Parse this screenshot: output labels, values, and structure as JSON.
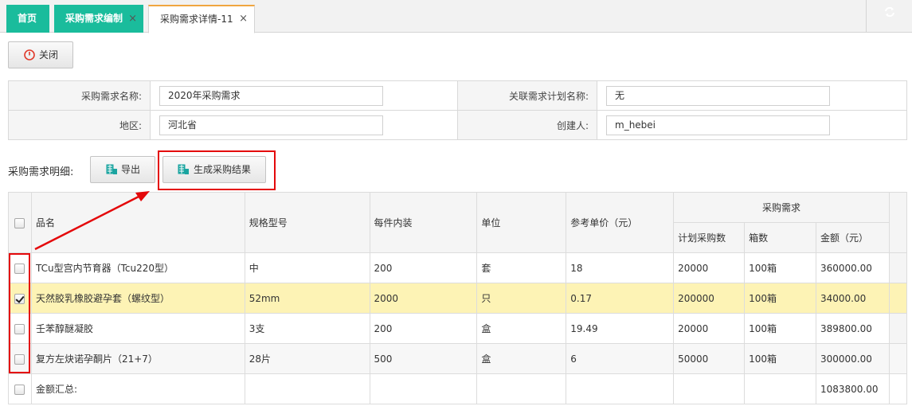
{
  "tabs": {
    "home": "首页",
    "edit": "采购需求编制",
    "detail": "采购需求详情-11",
    "close_glyph": "×"
  },
  "toolbar": {
    "close_label": "关闭"
  },
  "form": {
    "name_label": "采购需求名称:",
    "name_value": "2020年采购需求",
    "plan_label": "关联需求计划名称:",
    "plan_value": "无",
    "region_label": "地区:",
    "region_value": "河北省",
    "creator_label": "创建人:",
    "creator_value": "m_hebei"
  },
  "detail": {
    "label": "采购需求明细:",
    "export_label": "导出",
    "generate_label": "生成采购结果"
  },
  "grid": {
    "headers": {
      "name": "品名",
      "spec": "规格型号",
      "pack": "每件内装",
      "unit": "单位",
      "price": "参考单价（元）",
      "demand_group": "采购需求",
      "plan_qty": "计划采购数",
      "boxes": "箱数",
      "amount": "金额（元）"
    },
    "rows": [
      {
        "name": "TCu型宫内节育器（Tcu220型）",
        "spec": "中",
        "pack": "200",
        "unit": "套",
        "price": "18",
        "plan_qty": "20000",
        "boxes": "100箱",
        "amount": "360000.00",
        "checked": false
      },
      {
        "name": "天然胶乳橡胶避孕套（螺纹型）",
        "spec": "52mm",
        "pack": "2000",
        "unit": "只",
        "price": "0.17",
        "plan_qty": "200000",
        "boxes": "100箱",
        "amount": "34000.00",
        "checked": true
      },
      {
        "name": "壬苯醇醚凝胶",
        "spec": "3支",
        "pack": "200",
        "unit": "盒",
        "price": "19.49",
        "plan_qty": "20000",
        "boxes": "100箱",
        "amount": "389800.00",
        "checked": false
      },
      {
        "name": "复方左炔诺孕酮片（21+7）",
        "spec": "28片",
        "pack": "500",
        "unit": "盒",
        "price": "6",
        "plan_qty": "50000",
        "boxes": "100箱",
        "amount": "300000.00",
        "checked": false
      }
    ],
    "summary": {
      "label": "金额汇总:",
      "amount": "1083800.00"
    }
  },
  "colors": {
    "tab_green": "#1abc9c",
    "highlight_row": "#fdf3b5",
    "annotation_red": "#e4080a",
    "active_tab_accent": "#f0a640"
  }
}
